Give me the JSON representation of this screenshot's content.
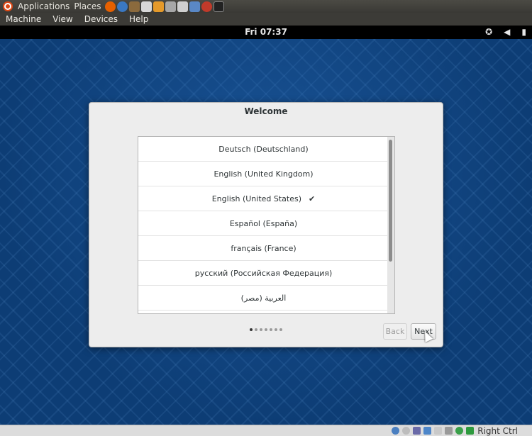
{
  "host_panel": {
    "menus": [
      "Applications",
      "Places"
    ],
    "launchers": [
      {
        "icon": "firefox-icon",
        "color": "#e66000"
      },
      {
        "icon": "thunderbird-icon",
        "color": "#3a78c2"
      },
      {
        "icon": "gimp-icon",
        "color": "#8b6a3d"
      },
      {
        "icon": "text-editor-icon",
        "color": "#d8d8d8"
      },
      {
        "icon": "folder-icon",
        "color": "#e59a2a"
      },
      {
        "icon": "games-icon",
        "color": "#a7a7a7"
      },
      {
        "icon": "screenshot-icon",
        "color": "#cfcfcf"
      },
      {
        "icon": "virtualbox-icon",
        "color": "#5a88c6"
      },
      {
        "icon": "ruby-icon",
        "color": "#c13a2a"
      },
      {
        "icon": "terminal-icon",
        "color": "#222222"
      }
    ]
  },
  "vm_menubar": {
    "items": [
      "Machine",
      "View",
      "Devices",
      "Help"
    ]
  },
  "gnome_bar": {
    "clock": "Fri 07:37",
    "icons": [
      "accessibility-icon",
      "volume-icon",
      "battery-icon"
    ]
  },
  "dialog": {
    "title": "Welcome",
    "languages": [
      {
        "label": "Deutsch (Deutschland)",
        "selected": false
      },
      {
        "label": "English (United Kingdom)",
        "selected": false
      },
      {
        "label": "English (United States)",
        "selected": true
      },
      {
        "label": "Español (España)",
        "selected": false
      },
      {
        "label": "français (France)",
        "selected": false
      },
      {
        "label": "русский (Российская Федерация)",
        "selected": false
      },
      {
        "label": "العربية (مصر)",
        "selected": false
      }
    ],
    "check_mark": "✔",
    "pages_total": 7,
    "page_current": 1,
    "back_label": "Back",
    "next_label": "Next"
  },
  "statusbar": {
    "host_key": "Right Ctrl"
  }
}
